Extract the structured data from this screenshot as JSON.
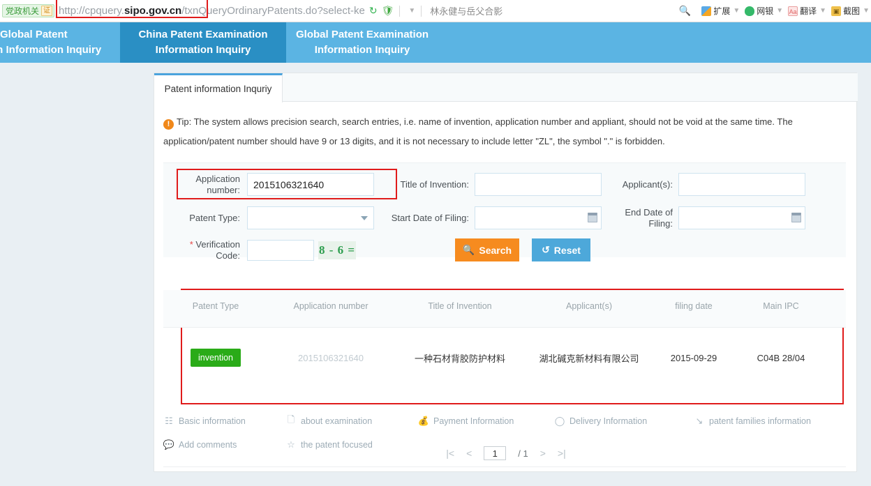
{
  "browser": {
    "gov_badge": "党政机关",
    "gov_cert": "证",
    "url_protocol": "http://cpquery.",
    "url_domain": "sipo.gov.cn",
    "url_path": "/txnQueryOrdinaryPatents.do?select-ke",
    "search_keyword": "林永健与岳父合影",
    "tools": [
      {
        "label": "扩展",
        "icon": "extensions-icon"
      },
      {
        "label": "网银",
        "icon": "online-banking-icon"
      },
      {
        "label": "翻译",
        "icon": "translate-icon"
      },
      {
        "label": "截图",
        "icon": "screenshot-icon"
      }
    ],
    "colors": {
      "refresh": "#2fb14d",
      "shield": "#3fa83f"
    }
  },
  "site_nav": {
    "tabs": [
      {
        "line1": "Global Patent",
        "line2": "on Information Inquiry",
        "active": false
      },
      {
        "line1": "China Patent Examination",
        "line2": "Information Inquiry",
        "active": true
      },
      {
        "line1": "Global Patent Examination",
        "line2": "Information Inquiry",
        "active": false
      }
    ],
    "colors": {
      "bar": "#5bb4e3",
      "active": "#2a8fc4"
    }
  },
  "panel": {
    "tab_label": "Patent information Inquriy",
    "tip_icon": "!",
    "tip_text": "Tip: The system allows precision search, search entries, i.e. name of invention, application number and appliant, should not be void at the same time. The application/patent number should have 9 or 13 digits, and it is not necessary to include letter \"ZL\", the symbol \".\" is forbidden."
  },
  "form": {
    "application_number": {
      "label": "Application number:",
      "value": "2015106321640"
    },
    "title_of_invention": {
      "label": "Title of Invention:",
      "value": ""
    },
    "applicants": {
      "label": "Applicant(s):",
      "value": ""
    },
    "patent_type": {
      "label": "Patent Type:",
      "value": ""
    },
    "start_date": {
      "label": "Start Date of Filing:",
      "value": ""
    },
    "end_date": {
      "label": "End Date of Filing:",
      "value": ""
    },
    "verification": {
      "label_req": "*",
      "label": " Verification Code:",
      "value": "",
      "captcha_text": "8 - 6 ="
    },
    "search_button": {
      "label": "Search",
      "icon": "search-icon",
      "color": "#f68b1f"
    },
    "reset_button": {
      "label": "Reset",
      "icon": "refresh-icon",
      "color": "#4da8da"
    }
  },
  "results": {
    "columns": [
      "Patent Type",
      "Application number",
      "Title of Invention",
      "Applicant(s)",
      "filing date",
      "Main IPC"
    ],
    "rows": [
      {
        "patent_type": "invention",
        "application_number": "2015106321640",
        "title_of_invention": "一种石材背胶防护材料",
        "applicants": "湖北碱克新材料有限公司",
        "filing_date": "2015-09-29",
        "main_ipc": "C04B 28/04"
      }
    ],
    "badge_color": "#2aab18",
    "highlight_color": "#e01b1b"
  },
  "actions": {
    "row1": [
      {
        "label": "Basic information",
        "icon": "basic-info-icon"
      },
      {
        "label": "about examination",
        "icon": "examination-icon"
      },
      {
        "label": "Payment Information",
        "icon": "payment-icon"
      },
      {
        "label": "Delivery Information",
        "icon": "delivery-icon"
      },
      {
        "label": "patent families information",
        "icon": "share-icon"
      }
    ],
    "row2": [
      {
        "label": "Add comments",
        "icon": "comment-icon"
      },
      {
        "label": "the patent focused",
        "icon": "star-icon"
      }
    ]
  },
  "pagination": {
    "first": "|<",
    "prev": "<",
    "current": "1",
    "total": "/ 1",
    "next": ">",
    "last": ">|"
  }
}
